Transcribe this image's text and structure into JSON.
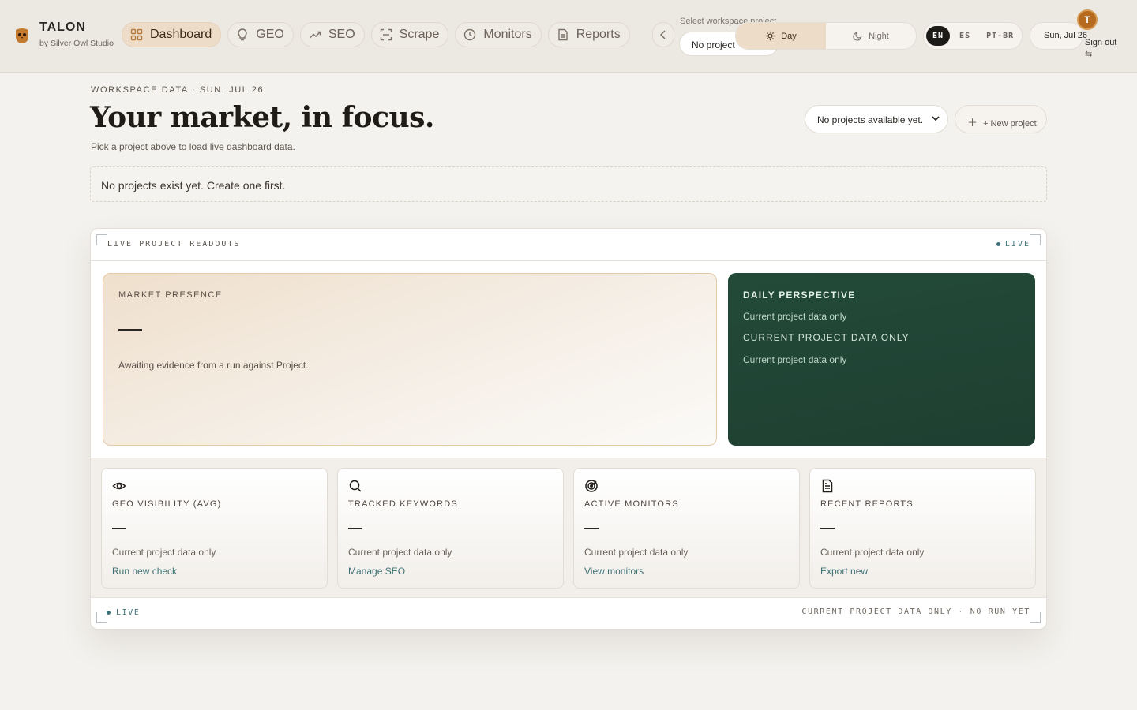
{
  "brand": {
    "name": "TALON",
    "tagline": "by Silver Owl Studio"
  },
  "nav": {
    "tabs": [
      {
        "label": "Dashboard",
        "icon": "grid-icon",
        "active": true
      },
      {
        "label": "GEO",
        "icon": "lightbulb-icon",
        "active": false
      },
      {
        "label": "SEO",
        "icon": "trend-up-icon",
        "active": false
      },
      {
        "label": "Scrape",
        "icon": "scan-icon",
        "active": false
      },
      {
        "label": "Monitors",
        "icon": "clock-icon",
        "active": false
      },
      {
        "label": "Reports",
        "icon": "document-icon",
        "active": false
      }
    ],
    "scroll_icon": "chevron-left-icon"
  },
  "workspace": {
    "label": "Select workspace project",
    "value": "No project"
  },
  "theme": {
    "day": "Day",
    "night": "Night",
    "active": "day"
  },
  "lang": {
    "options": [
      "EN",
      "ES",
      "PT-BR"
    ],
    "active": "EN"
  },
  "date_pill": "Sun, Jul 26",
  "user": {
    "initial": "T",
    "signout": "Sign out",
    "switch_icon": "⇆"
  },
  "header": {
    "eyebrow": "WORKSPACE DATA · SUN, JUL 26",
    "title": "Your market, in focus.",
    "subtitle": "Pick a project above to load live dashboard data.",
    "project_select": "No projects available yet.",
    "new_project": "+ New project"
  },
  "notice": "No projects exist yet. Create one first.",
  "panel": {
    "title": "LIVE PROJECT READOUTS",
    "live": "LIVE",
    "market": {
      "label": "MARKET PRESENCE",
      "message": "Awaiting evidence from a run against Project."
    },
    "perspective": {
      "title": "DAILY PERSPECTIVE",
      "line1": "Current project data only",
      "line2": "CURRENT PROJECT DATA ONLY",
      "line3": "Current project data only"
    },
    "cards": [
      {
        "label": "GEO VISIBILITY (AVG)",
        "sub": "Current project data only",
        "action": "Run new check",
        "icon": "eye-icon"
      },
      {
        "label": "TRACKED KEYWORDS",
        "sub": "Current project data only",
        "action": "Manage SEO",
        "icon": "search-icon"
      },
      {
        "label": "ACTIVE MONITORS",
        "sub": "Current project data only",
        "action": "View monitors",
        "icon": "target-icon"
      },
      {
        "label": "RECENT REPORTS",
        "sub": "Current project data only",
        "action": "Export new",
        "icon": "document-icon"
      }
    ],
    "footer_live": "LIVE",
    "footer_status": "CURRENT PROJECT DATA ONLY · NO RUN YET"
  },
  "colors": {
    "accent": "#b56a1f",
    "green_panel": "#234a39",
    "link": "#3d6f73",
    "active_tab": "#eddcc8"
  }
}
